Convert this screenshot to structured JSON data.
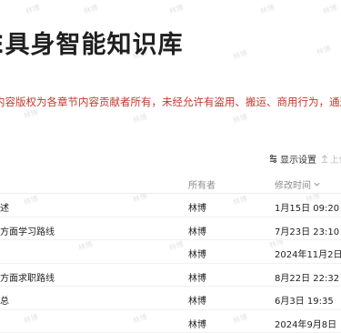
{
  "header": {
    "title": "E具身智能知识库"
  },
  "notice": "内容版权为各章节内容贡献者所有，未经允许有盗用、搬运、商用行为，通过大数据和",
  "watermark_text": "林博",
  "toolbar": {
    "display_settings_label": "显示设置",
    "upload_label": "上传"
  },
  "table": {
    "columns": {
      "owner": "所有者",
      "modified": "修改时间"
    },
    "rows": [
      {
        "name": "述",
        "owner": "林博",
        "modified": "1月15日 09:20"
      },
      {
        "name": "方面学习路线",
        "owner": "林博",
        "modified": "7月23日 23:10"
      },
      {
        "name": "",
        "owner": "林博",
        "modified": "2024年11月2日"
      },
      {
        "name": "方面求职路线",
        "owner": "林博",
        "modified": "8月22日 22:32"
      },
      {
        "name": "总",
        "owner": "林博",
        "modified": "6月3日 19:35"
      },
      {
        "name": "",
        "owner": "林博",
        "modified": "2024年9月8日"
      }
    ]
  }
}
